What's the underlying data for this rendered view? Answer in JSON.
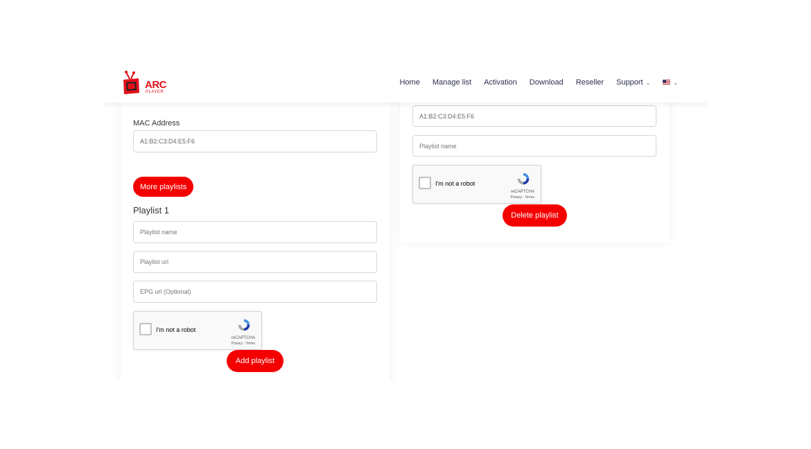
{
  "nav": {
    "logo_text": "ARC",
    "logo_sub": "PLAYER",
    "links": [
      "Home",
      "Manage list",
      "Activation",
      "Download",
      "Reseller"
    ],
    "support_label": "Support",
    "language_icon": "us-flag-icon"
  },
  "left_card": {
    "mac_label": "MAC Address",
    "mac_value": "A1:B2:C3:D4:E5:F6",
    "more_playlists_label": "More playlists",
    "playlist_title": "Playlist 1",
    "playlist_name_placeholder": "Playlist name",
    "playlist_url_placeholder": "Playlist url",
    "epg_url_placeholder": "EPG url (Optional)",
    "captcha_label": "I'm not a robot",
    "captcha_brand": "reCAPTCHA",
    "captcha_terms": "Privacy - Terms",
    "add_playlist_label": "Add playlist"
  },
  "right_card": {
    "mac_value": "A1:B2:C3:D4:E5:F6",
    "playlist_name_placeholder": "Playlist name",
    "captcha_label": "I'm not a robot",
    "captcha_brand": "reCAPTCHA",
    "captcha_terms": "Privacy - Terms",
    "delete_playlist_label": "Delete playlist"
  },
  "colors": {
    "accent": "#f50000",
    "nav_text": "#2b2f4c"
  }
}
